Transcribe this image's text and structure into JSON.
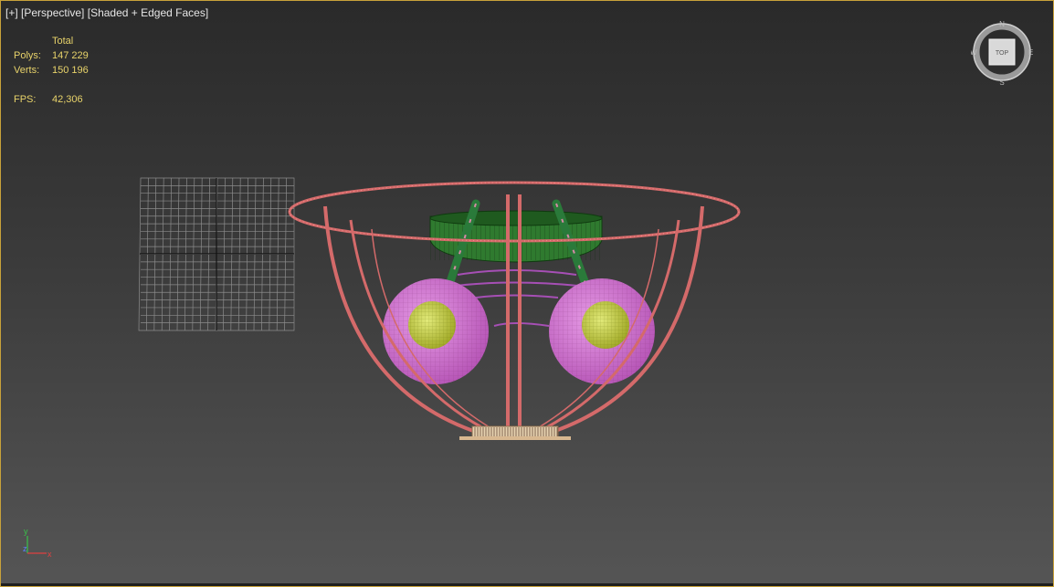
{
  "viewport": {
    "plus": "[+]",
    "view": "[Perspective]",
    "shading": "[Shaded + Edged Faces]"
  },
  "stats": {
    "header": "Total",
    "polys_label": "Polys:",
    "polys_value": "147 229",
    "verts_label": "Verts:",
    "verts_value": "150 196",
    "fps_label": "FPS:",
    "fps_value": "42,306"
  },
  "viewcube": {
    "face": "TOP",
    "north": "N",
    "south": "S",
    "west": "W",
    "east": "E"
  },
  "axis_gizmo": {
    "y": "y",
    "z": "z",
    "x": "x"
  },
  "colors": {
    "frame_wire": "#d46a6a",
    "sphere": "#cc66cc",
    "bulb": "#c8d23a",
    "plate": "#3e8a3e",
    "grid": "#8c8c8c",
    "border": "#c8a23a"
  }
}
